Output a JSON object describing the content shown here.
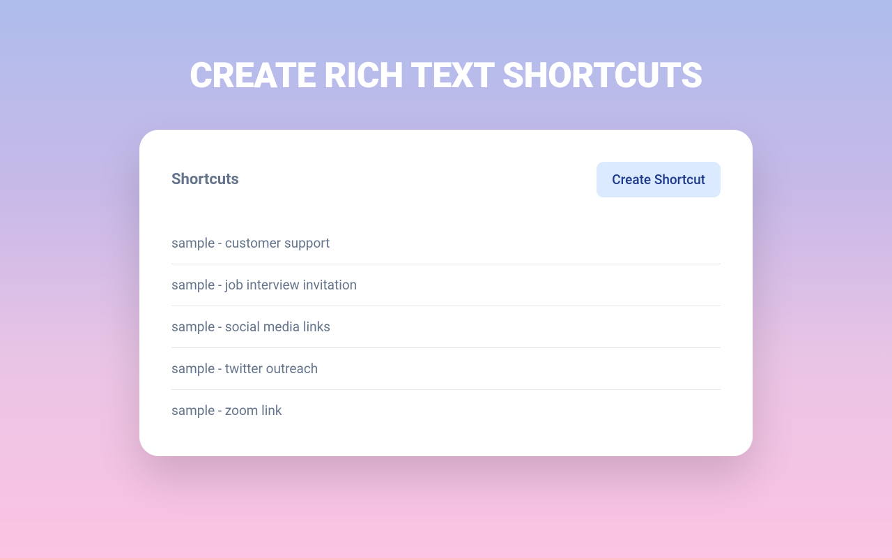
{
  "page": {
    "title": "Create Rich Text Shortcuts"
  },
  "card": {
    "heading": "Shortcuts",
    "create_button_label": "Create Shortcut"
  },
  "shortcuts": [
    {
      "label": "sample - customer support"
    },
    {
      "label": "sample - job interview invitation"
    },
    {
      "label": "sample - social media links"
    },
    {
      "label": "sample - twitter outreach"
    },
    {
      "label": "sample - zoom link"
    }
  ]
}
